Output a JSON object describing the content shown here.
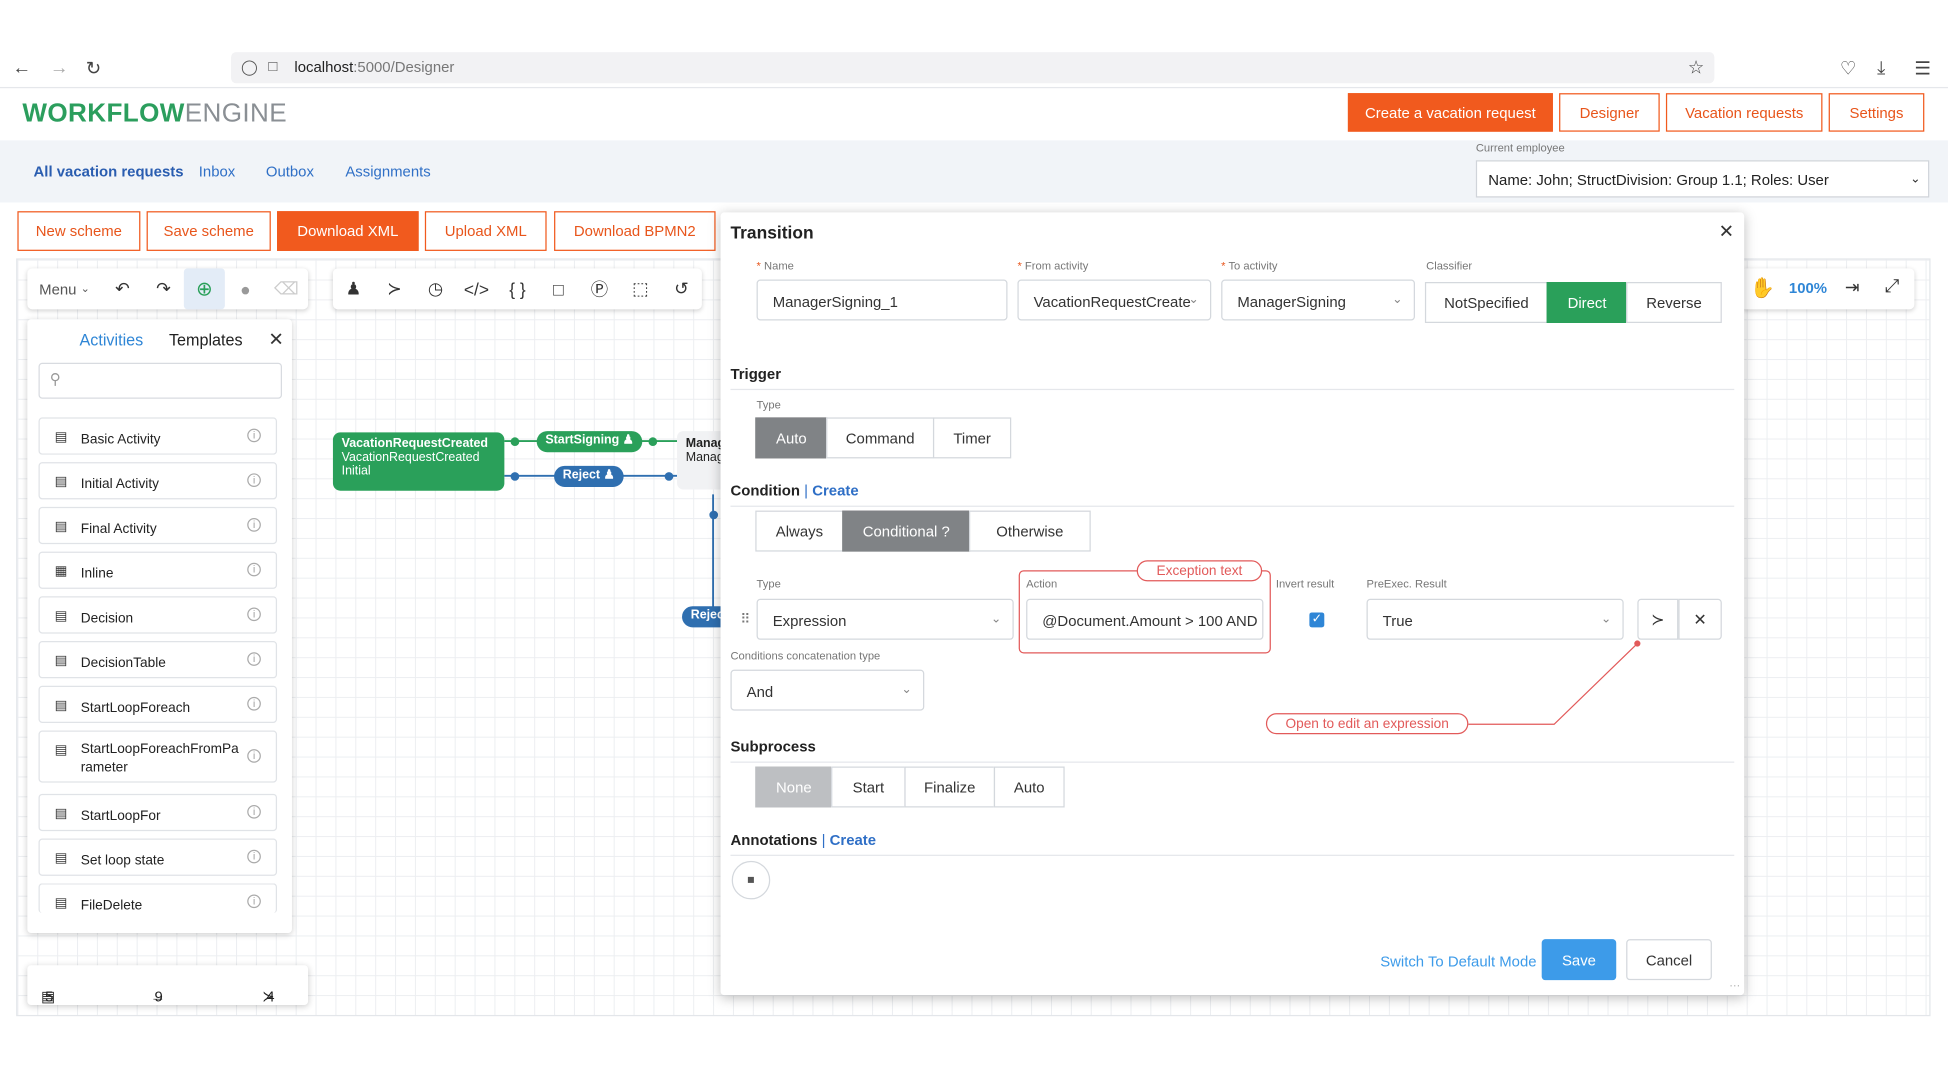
{
  "browser": {
    "url_host": "localhost",
    "url_rest": ":5000/Designer",
    "icons": [
      "back-icon",
      "forward-icon",
      "reload-icon",
      "shield-icon",
      "page-icon",
      "star-icon",
      "pocket-icon",
      "download-icon",
      "menu-icon"
    ]
  },
  "app": {
    "logo_strong": "WORKFLOW",
    "logo_light": "ENGINE",
    "header_buttons": [
      "Create a vacation request",
      "Designer",
      "Vacation requests",
      "Settings"
    ],
    "nav_links": [
      "All vacation requests",
      "Inbox",
      "Outbox",
      "Assignments"
    ],
    "current_employee_label": "Current employee",
    "current_employee_value": "Name: John; StructDivision: Group 1.1; Roles: User",
    "scheme_buttons": [
      "New scheme",
      "Save scheme",
      "Download XML",
      "Upload XML",
      "Download BPMN2"
    ]
  },
  "toolbar": {
    "menu_label": "Menu",
    "zoom_level": "100%"
  },
  "panel": {
    "tab_activities": "Activities",
    "tab_templates": "Templates",
    "items": [
      "Basic Activity",
      "Initial Activity",
      "Final Activity",
      "Inline",
      "Decision",
      "DecisionTable",
      "StartLoopForeach",
      "StartLoopForeachFromPa rameter",
      "StartLoopFor",
      "Set loop state",
      "FileDelete"
    ]
  },
  "stats": {
    "activities": "5",
    "transitions": "9",
    "commands": "4"
  },
  "diagram": {
    "node_title": "VacationRequestCreated",
    "node_sub": "VacationRequestCreated",
    "node_state": "Initial",
    "pill_start": "StartSigning",
    "pill_reject": "Reject",
    "pill_reject2": "Rejec",
    "node2_a": "Manag",
    "node2_b": "Manag"
  },
  "dialog": {
    "title": "Transition",
    "name_label": "Name",
    "name_value": "ManagerSigning_1",
    "from_label": "From activity",
    "from_value": "VacationRequestCreate",
    "to_label": "To activity",
    "to_value": "ManagerSigning",
    "classifier_label": "Classifier",
    "classifier_options": [
      "NotSpecified",
      "Direct",
      "Reverse"
    ],
    "trigger_title": "Trigger",
    "trigger_type_label": "Type",
    "trigger_options": [
      "Auto",
      "Command",
      "Timer"
    ],
    "condition_title": "Condition",
    "condition_create": "Create",
    "condition_options": [
      "Always",
      "Conditional ?",
      "Otherwise"
    ],
    "cond_type_label": "Type",
    "cond_type_value": "Expression",
    "action_label": "Action",
    "action_value": "@Document.Amount > 100 AND",
    "invert_label": "Invert result",
    "preexec_label": "PreExec. Result",
    "preexec_value": "True",
    "concat_label": "Conditions concatenation type",
    "concat_value": "And",
    "note_exception": "Exception text",
    "note_expression": "Open to edit an expression",
    "subprocess_title": "Subprocess",
    "subprocess_options": [
      "None",
      "Start",
      "Finalize",
      "Auto"
    ],
    "annotations_title": "Annotations",
    "annotations_create": "Create",
    "switch_mode": "Switch To Default Mode",
    "save": "Save",
    "cancel": "Cancel"
  },
  "colors": {
    "brand_orange": "#f15a1e",
    "green": "#2aa05a",
    "blue": "#2f6fc6",
    "note_red": "#e25a5a"
  }
}
